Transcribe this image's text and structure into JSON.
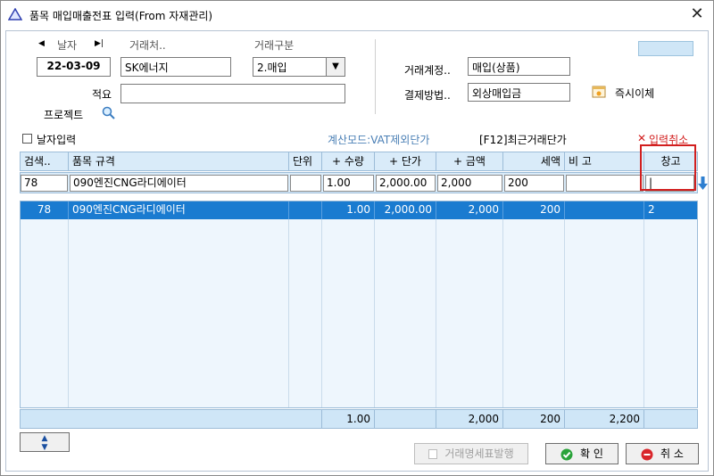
{
  "window": {
    "title": "품목 매입매출전표 입력(From 자재관리)"
  },
  "header": {
    "date_label": "날자",
    "date_value": "22-03-09",
    "customer_label": "거래처..",
    "customer_value": "SK에너지",
    "trade_type_label": "거래구분",
    "trade_type_value": "2.매입",
    "memo_label": "적요",
    "memo_value": "",
    "project_label": "프로젝트",
    "account_label": "거래계정..",
    "account_value": "매입(상품)",
    "payment_label": "결제방법..",
    "payment_value": "외상매입금",
    "instant_transfer_label": "즉시이체"
  },
  "options": {
    "date_input_label": "날자입력",
    "calc_mode_text": "계산모드:VAT제외단가",
    "recent_price_text": "[F12]최근거래단가",
    "cancel_input_text": "입력취소"
  },
  "grid": {
    "headers": [
      "검색..",
      "품목 규격",
      "단위",
      "+ 수량",
      "+ 단가",
      "+ 금액",
      "세액",
      "비 고",
      "창고"
    ],
    "edit_row": [
      "78",
      "090엔진CNG라디에이터",
      "",
      "1.00",
      "2,000.00",
      "2,000",
      "200",
      "",
      "|"
    ],
    "rows": [
      [
        "78",
        "090엔진CNG라디에이터",
        "",
        "1.00",
        "2,000.00",
        "2,000",
        "200",
        "",
        "2"
      ]
    ],
    "totals": [
      "",
      "",
      "",
      "1.00",
      "",
      "2,000",
      "200",
      "2,200",
      ""
    ]
  },
  "footer": {
    "statement_button": "거래명세표발행",
    "ok_button": "확 인",
    "cancel_button": "취 소"
  },
  "colors": {
    "selection": "#1a7bd0",
    "grid_header": "#d9ebf9",
    "cancel_red": "#d21f1f",
    "calc_mode_blue": "#4a7fb5"
  }
}
